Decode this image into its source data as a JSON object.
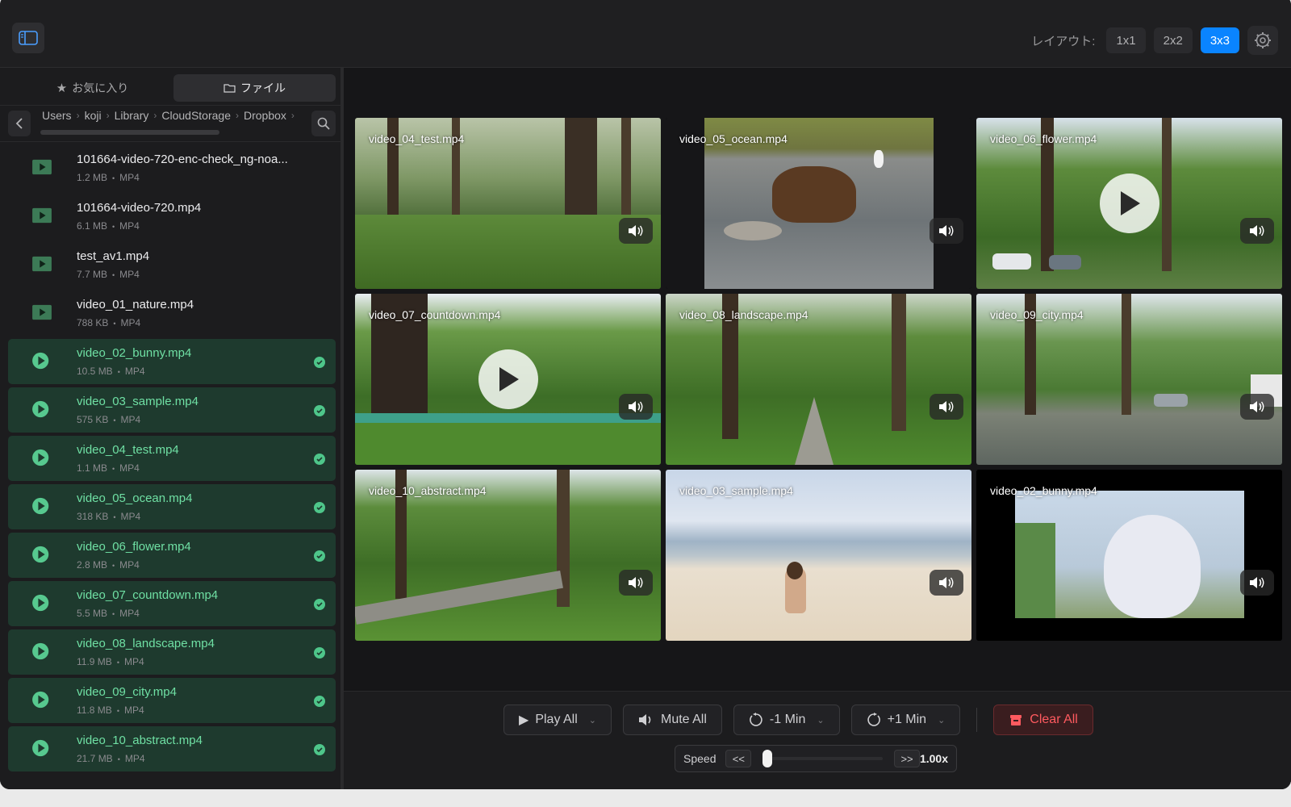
{
  "toolbar": {
    "layout_label": "レイアウト:",
    "layout_options": [
      "1x1",
      "2x2",
      "3x3"
    ],
    "active_layout": "3x3",
    "accent": "#0a84ff"
  },
  "sidebar": {
    "tabs": [
      {
        "label": "お気に入り",
        "icon": "star-icon",
        "active": false
      },
      {
        "label": "ファイル",
        "icon": "folder-icon",
        "active": true
      }
    ],
    "breadcrumbs": [
      "Users",
      "koji",
      "Library",
      "CloudStorage",
      "Dropbox"
    ],
    "files": [
      {
        "name": "101664-video-720-enc-check_ng-noa...",
        "size": "1.2 MB",
        "type": "MP4",
        "selected": false
      },
      {
        "name": "101664-video-720.mp4",
        "size": "6.1 MB",
        "type": "MP4",
        "selected": false
      },
      {
        "name": "test_av1.mp4",
        "size": "7.7 MB",
        "type": "MP4",
        "selected": false
      },
      {
        "name": "video_01_nature.mp4",
        "size": "788 KB",
        "type": "MP4",
        "selected": false
      },
      {
        "name": "video_02_bunny.mp4",
        "size": "10.5 MB",
        "type": "MP4",
        "selected": true
      },
      {
        "name": "video_03_sample.mp4",
        "size": "575 KB",
        "type": "MP4",
        "selected": true
      },
      {
        "name": "video_04_test.mp4",
        "size": "1.1 MB",
        "type": "MP4",
        "selected": true
      },
      {
        "name": "video_05_ocean.mp4",
        "size": "318 KB",
        "type": "MP4",
        "selected": true
      },
      {
        "name": "video_06_flower.mp4",
        "size": "2.8 MB",
        "type": "MP4",
        "selected": true
      },
      {
        "name": "video_07_countdown.mp4",
        "size": "5.5 MB",
        "type": "MP4",
        "selected": true
      },
      {
        "name": "video_08_landscape.mp4",
        "size": "11.9 MB",
        "type": "MP4",
        "selected": true
      },
      {
        "name": "video_09_city.mp4",
        "size": "11.8 MB",
        "type": "MP4",
        "selected": true
      },
      {
        "name": "video_10_abstract.mp4",
        "size": "21.7 MB",
        "type": "MP4",
        "selected": true
      }
    ],
    "meta_sep": "•",
    "selected_color": "#6fe0a4"
  },
  "grid": {
    "tiles": [
      {
        "title": "video_04_test.mp4",
        "scene": "forest",
        "paused": false
      },
      {
        "title": "video_05_ocean.mp4",
        "scene": "river-bear",
        "paused": false
      },
      {
        "title": "video_06_flower.mp4",
        "scene": "park-cars",
        "paused": true
      },
      {
        "title": "video_07_countdown.mp4",
        "scene": "park",
        "paused": true
      },
      {
        "title": "video_08_landscape.mp4",
        "scene": "park-path",
        "paused": false
      },
      {
        "title": "video_09_city.mp4",
        "scene": "city-street",
        "paused": false
      },
      {
        "title": "video_10_abstract.mp4",
        "scene": "park-path2",
        "paused": false
      },
      {
        "title": "video_03_sample.mp4",
        "scene": "beach",
        "paused": false
      },
      {
        "title": "video_02_bunny.mp4",
        "scene": "bunny",
        "paused": false
      }
    ]
  },
  "controls": {
    "play_all": "Play All",
    "mute_all": "Mute All",
    "minus_min": "-1 Min",
    "plus_min": "+1 Min",
    "clear_all": "Clear All",
    "speed_label": "Speed",
    "speed_down": "<<",
    "speed_up": ">>",
    "speed_value": "1.00x",
    "speed_fraction": 0.0,
    "clear_color": "#ff5a5f"
  }
}
